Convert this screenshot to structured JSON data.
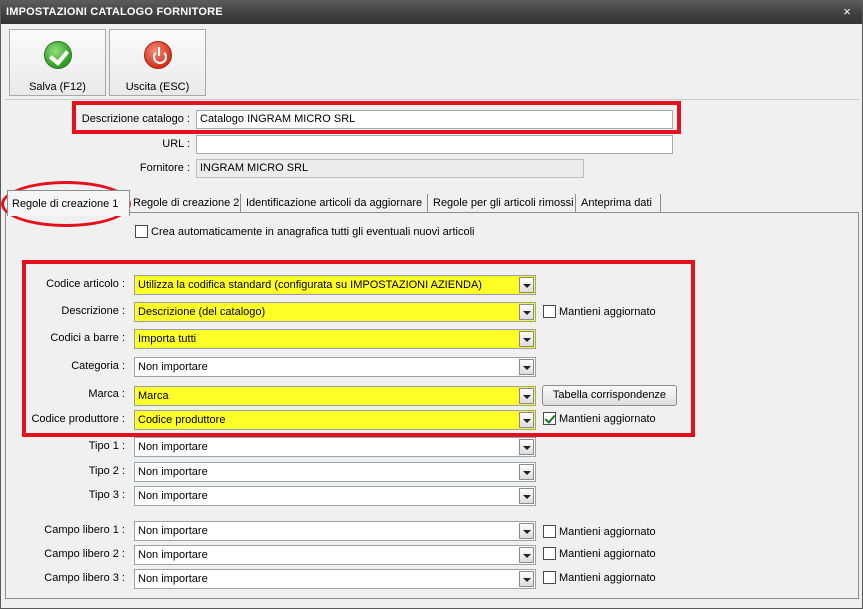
{
  "window": {
    "title": "IMPOSTAZIONI CATALOGO FORNITORE",
    "close_glyph": "×"
  },
  "toolbar": {
    "save_label": "Salva (F12)",
    "exit_label": "Uscita (ESC)",
    "save_icon": "check-circle-icon",
    "exit_icon": "power-icon"
  },
  "header_fields": {
    "descrizione_label": "Descrizione catalogo :",
    "descrizione_value": "Catalogo INGRAM MICRO SRL",
    "url_label": "URL :",
    "url_value": "",
    "fornitore_label": "Fornitore :",
    "fornitore_value": "INGRAM MICRO SRL"
  },
  "tabs": [
    {
      "label": "Regole di creazione 1",
      "active": true
    },
    {
      "label": "Regole di creazione 2",
      "active": false
    },
    {
      "label": "Identificazione articoli da aggiornare",
      "active": false
    },
    {
      "label": "Regole per gli articoli rimossi",
      "active": false
    },
    {
      "label": "Anteprima dati",
      "active": false
    }
  ],
  "auto_create": {
    "label": "Crea automaticamente in anagrafica tutti gli eventuali nuovi articoli",
    "checked": false
  },
  "rows": [
    {
      "label": "Codice articolo :",
      "value": "Utilizza la codifica standard (configurata su IMPOSTAZIONI AZIENDA)",
      "highlight": true
    },
    {
      "label": "Descrizione :",
      "value": "Descrizione (del catalogo)",
      "highlight": true,
      "keep_updated": {
        "label": "Mantieni aggiornato",
        "checked": false
      }
    },
    {
      "label": "Codici a barre :",
      "value": "Importa tutti",
      "highlight": true
    },
    {
      "label": "Categoria :",
      "value": "Non importare",
      "highlight": false
    },
    {
      "label": "Marca :",
      "value": "Marca",
      "highlight": true,
      "button": "Tabella corrispondenze"
    },
    {
      "label": "Codice produttore :",
      "value": "Codice produttore",
      "highlight": true,
      "keep_updated": {
        "label": "Mantieni aggiornato",
        "checked": true
      }
    },
    {
      "label": "Tipo 1 :",
      "value": "Non importare",
      "highlight": false
    },
    {
      "label": "Tipo 2 :",
      "value": "Non importare",
      "highlight": false
    },
    {
      "label": "Tipo 3 :",
      "value": "Non importare",
      "highlight": false
    },
    {
      "label": "Campo libero 1 :",
      "value": "Non importare",
      "highlight": false,
      "keep_updated": {
        "label": "Mantieni aggiornato",
        "checked": false
      }
    },
    {
      "label": "Campo libero 2 :",
      "value": "Non importare",
      "highlight": false,
      "keep_updated": {
        "label": "Mantieni aggiornato",
        "checked": false
      }
    },
    {
      "label": "Campo libero 3 :",
      "value": "Non importare",
      "highlight": false,
      "keep_updated": {
        "label": "Mantieni aggiornato",
        "checked": false
      }
    }
  ],
  "colors": {
    "highlight": "#ffff28",
    "annotation": "#e4101d",
    "titlebar": "#3e3e3e"
  }
}
